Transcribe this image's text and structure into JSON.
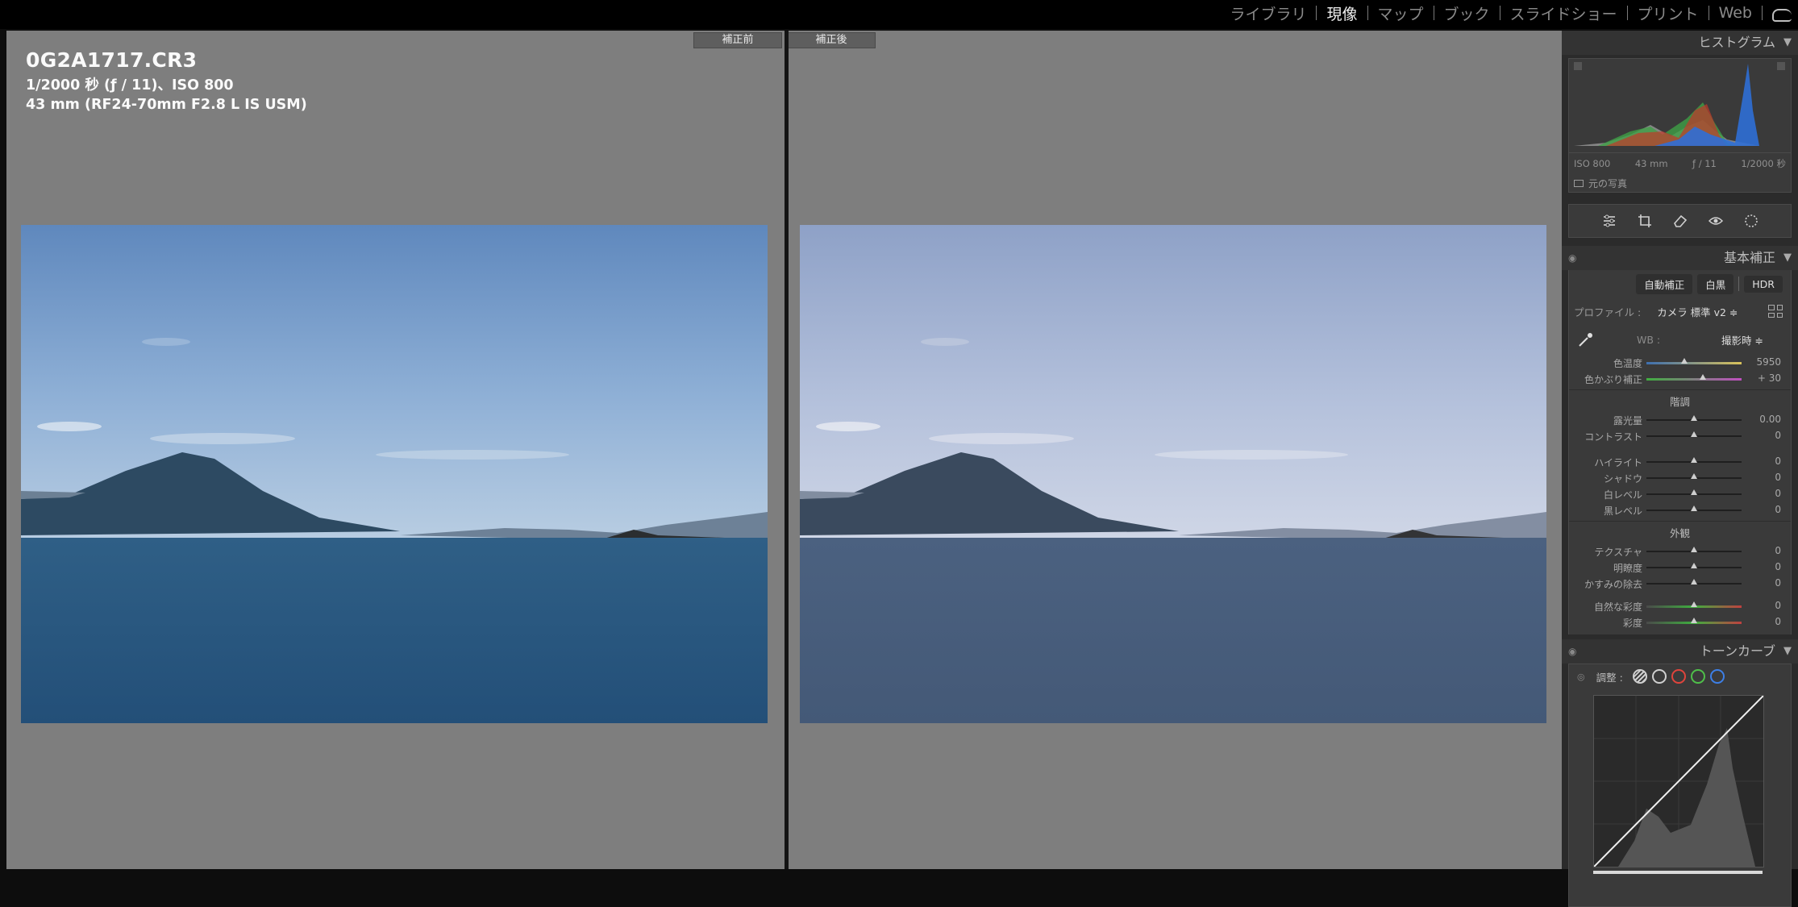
{
  "modules": {
    "items": [
      "ライブラリ",
      "現像",
      "マップ",
      "ブック",
      "スライドショー",
      "プリント",
      "Web"
    ],
    "active": "現像"
  },
  "compare": {
    "before_label": "補正前",
    "after_label": "補正後"
  },
  "info": {
    "filename": "0G2A1717.CR3",
    "exposure": "1/2000 秒 (ƒ / 11)、ISO 800",
    "lens": "43 mm (RF24-70mm F2.8 L IS USM)"
  },
  "histogram": {
    "title": "ヒストグラム",
    "iso": "ISO 800",
    "focal": "43 mm",
    "aperture": "ƒ / 11",
    "shutter": "1/2000 秒",
    "original_photo": "元の写真"
  },
  "tools": [
    "sliders-icon",
    "crop-icon",
    "eraser-icon",
    "redeye-icon",
    "masking-icon"
  ],
  "basic": {
    "title": "基本補正",
    "auto": "自動補正",
    "bw": "白黒",
    "hdr": "HDR",
    "profile_label": "プロファイル :",
    "profile_value": "カメラ 標準 v2 ≑",
    "wb_label": "WB :",
    "wb_value": "撮影時 ≑",
    "temp": {
      "label": "色温度",
      "value": "5950",
      "pos": 0.4
    },
    "tint": {
      "label": "色かぶり補正",
      "value": "+ 30",
      "pos": 0.59
    },
    "tone_title": "階調",
    "exposure": {
      "label": "露光量",
      "value": "0.00",
      "pos": 0.5
    },
    "contrast": {
      "label": "コントラスト",
      "value": "0",
      "pos": 0.5
    },
    "highlights": {
      "label": "ハイライト",
      "value": "0",
      "pos": 0.5
    },
    "shadows": {
      "label": "シャドウ",
      "value": "0",
      "pos": 0.5
    },
    "whites": {
      "label": "白レベル",
      "value": "0",
      "pos": 0.5
    },
    "blacks": {
      "label": "黒レベル",
      "value": "0",
      "pos": 0.5
    },
    "presence_title": "外観",
    "texture": {
      "label": "テクスチャ",
      "value": "0",
      "pos": 0.5
    },
    "clarity": {
      "label": "明瞭度",
      "value": "0",
      "pos": 0.5
    },
    "dehaze": {
      "label": "かすみの除去",
      "value": "0",
      "pos": 0.5
    },
    "vibrance": {
      "label": "自然な彩度",
      "value": "0",
      "pos": 0.5
    },
    "saturation": {
      "label": "彩度",
      "value": "0",
      "pos": 0.5
    }
  },
  "tonecurve": {
    "title": "トーンカーブ",
    "adjust_label": "調整 :",
    "colors": {
      "parametric": "#cfcfcf",
      "point": "#cfcfcf",
      "red": "#e0443c",
      "green": "#4fbf4a",
      "blue": "#3d7fe6"
    }
  }
}
